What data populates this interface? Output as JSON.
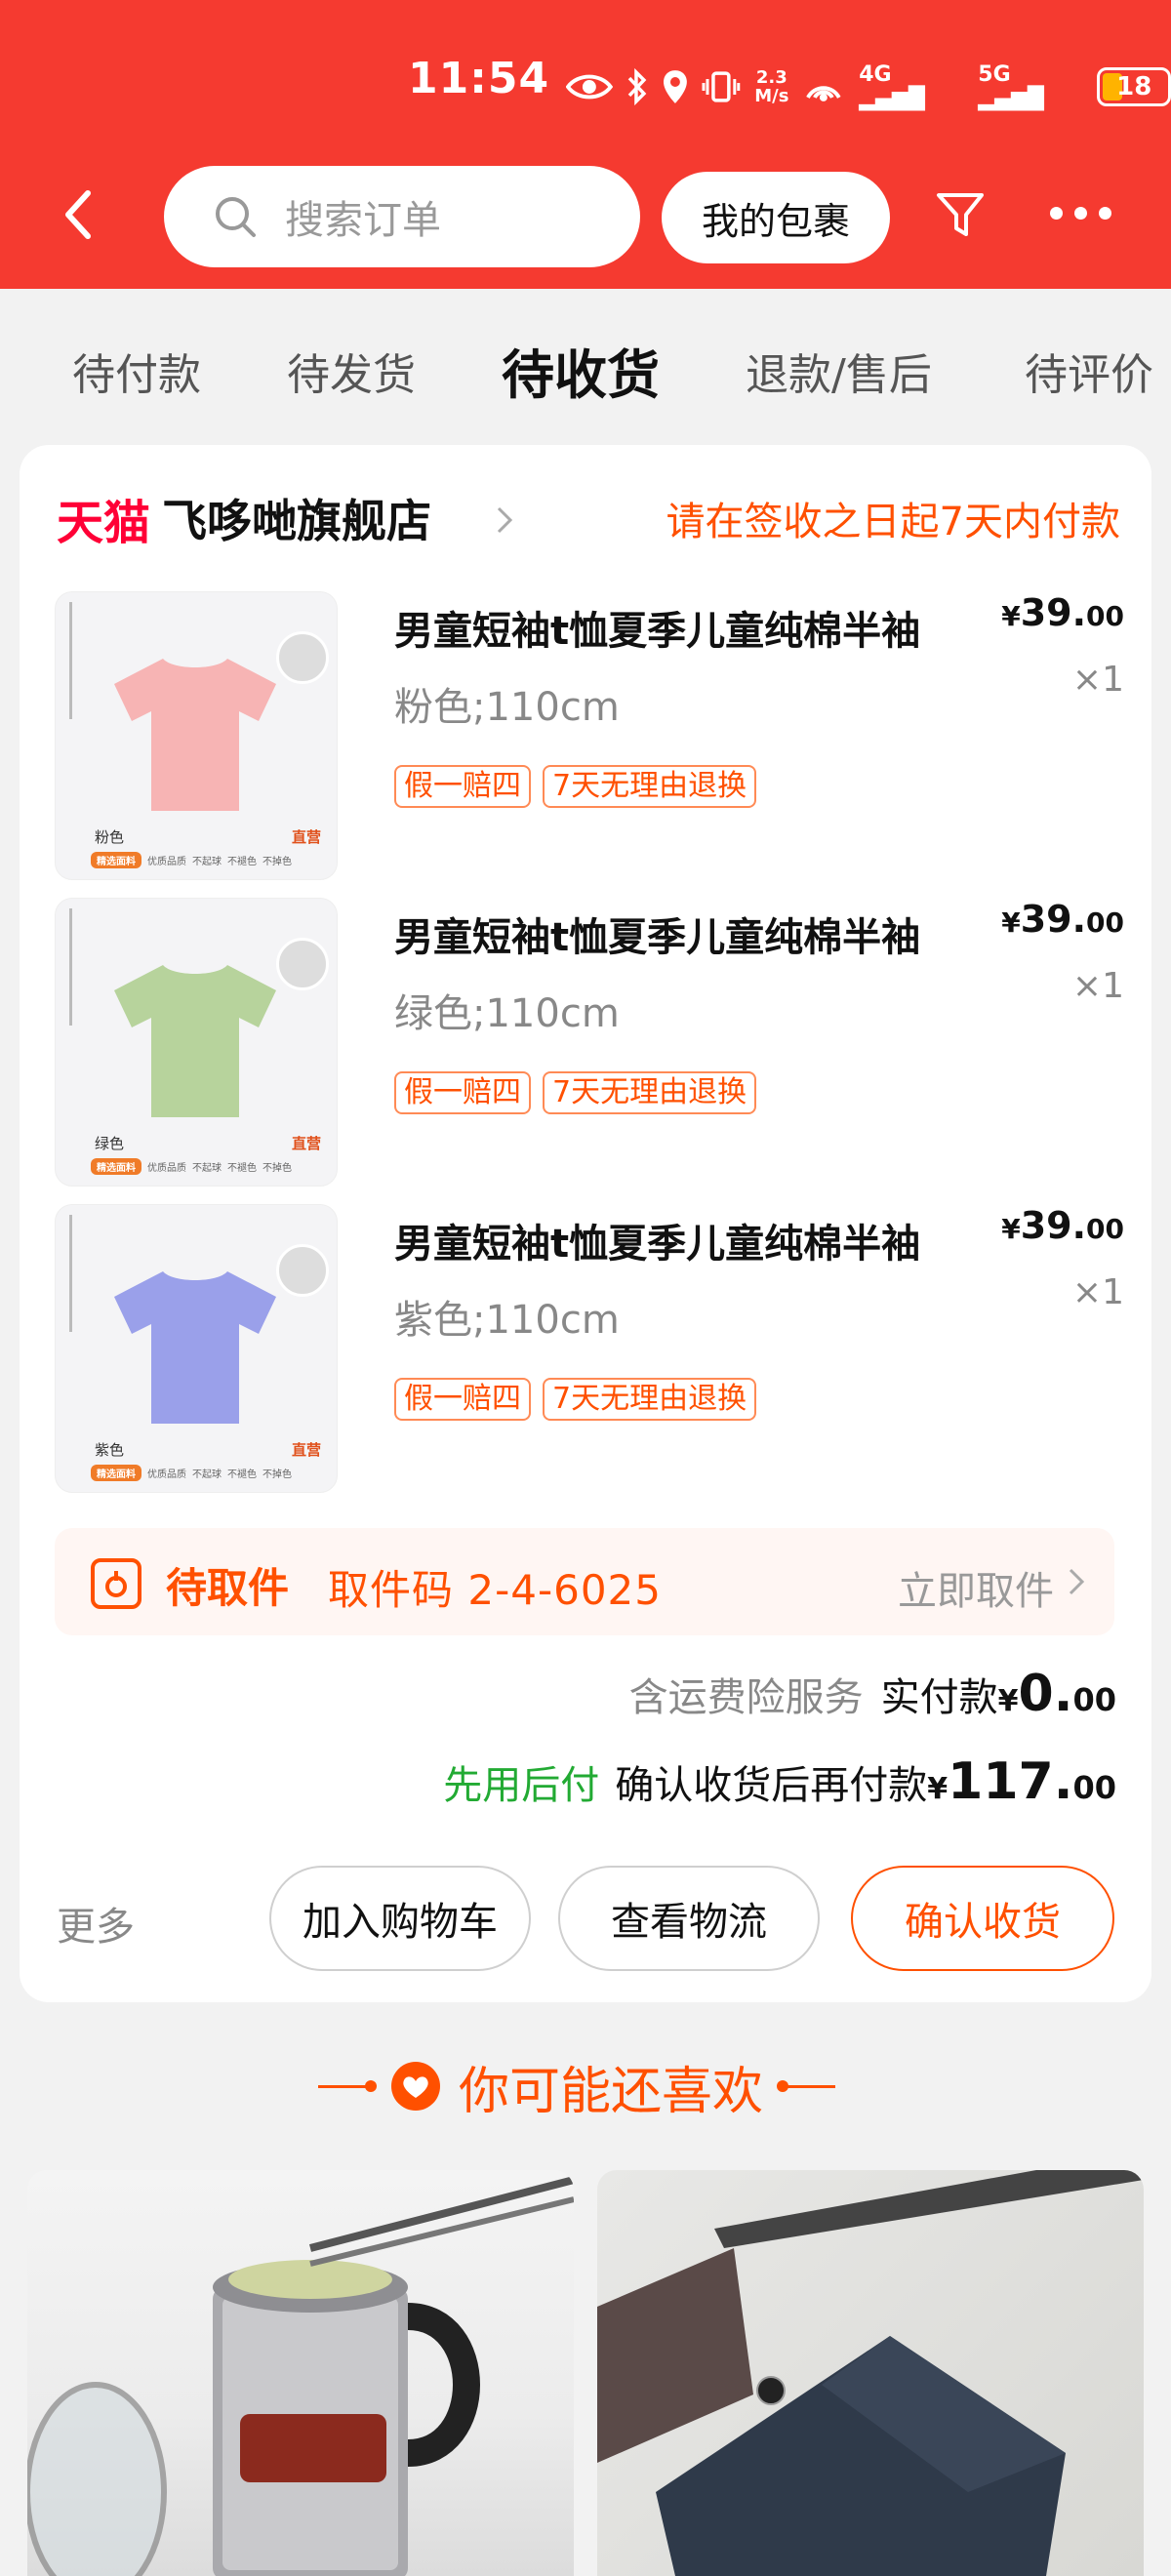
{
  "status_bar": {
    "time": "11:54",
    "net_speed_value": "2.3",
    "net_speed_unit": "M/s",
    "battery": "18",
    "signal_1": "4G",
    "signal_2": "5G"
  },
  "header": {
    "search_placeholder": "搜索订单",
    "my_packages": "我的包裹"
  },
  "tabs": [
    "待付款",
    "待发货",
    "待收货",
    "退款/售后",
    "待评价"
  ],
  "active_tab": "待收货",
  "order": {
    "store_badge": "天猫",
    "store_name": "飞哆哋旗舰店",
    "payment_note": "请在签收之日起7天内付款",
    "items": [
      {
        "title": "男童短袖t恤夏季儿童纯棉半袖",
        "spec": "粉色;110cm",
        "price_int": "39.",
        "price_dec": "00",
        "qty": "×1",
        "thumb_color_label": "粉色",
        "shirt_color": "#f7b4b4",
        "tags": [
          "假一赔四",
          "7天无理由退换"
        ]
      },
      {
        "title": "男童短袖t恤夏季儿童纯棉半袖",
        "spec": "绿色;110cm",
        "price_int": "39.",
        "price_dec": "00",
        "qty": "×1",
        "thumb_color_label": "绿色",
        "shirt_color": "#b7d39c",
        "tags": [
          "假一赔四",
          "7天无理由退换"
        ]
      },
      {
        "title": "男童短袖t恤夏季儿童纯棉半袖",
        "spec": "紫色;110cm",
        "price_int": "39.",
        "price_dec": "00",
        "qty": "×1",
        "thumb_color_label": "紫色",
        "shirt_color": "#9aa0ea",
        "tags": [
          "假一赔四",
          "7天无理由退换"
        ]
      }
    ],
    "thumb_direct": "直营",
    "thumb_strip": [
      "精选面料",
      "优质品质",
      "不起球",
      "不褪色",
      "不掉色"
    ],
    "pickup": {
      "status": "待取件",
      "code": "取件码 2-4-6025",
      "action": "立即取件"
    },
    "insurance": "含运费险服务",
    "paid_label": "实付款",
    "paid_yen": "¥",
    "paid_int": "0.",
    "paid_dec": "00",
    "bnpl": "先用后付",
    "after_label": "确认收货后再付款",
    "after_yen": "¥",
    "after_int": "117.",
    "after_dec": "00",
    "more": "更多",
    "buttons": {
      "cart": "加入购物车",
      "logistics": "查看物流",
      "confirm": "确认收货"
    }
  },
  "recommend": {
    "title": "你可能还喜欢"
  },
  "colors": {
    "brand_red": "#f53a30",
    "accent_orange": "#ff5000",
    "tmall_red": "#ff0036",
    "bnpl_green": "#22aa33"
  }
}
